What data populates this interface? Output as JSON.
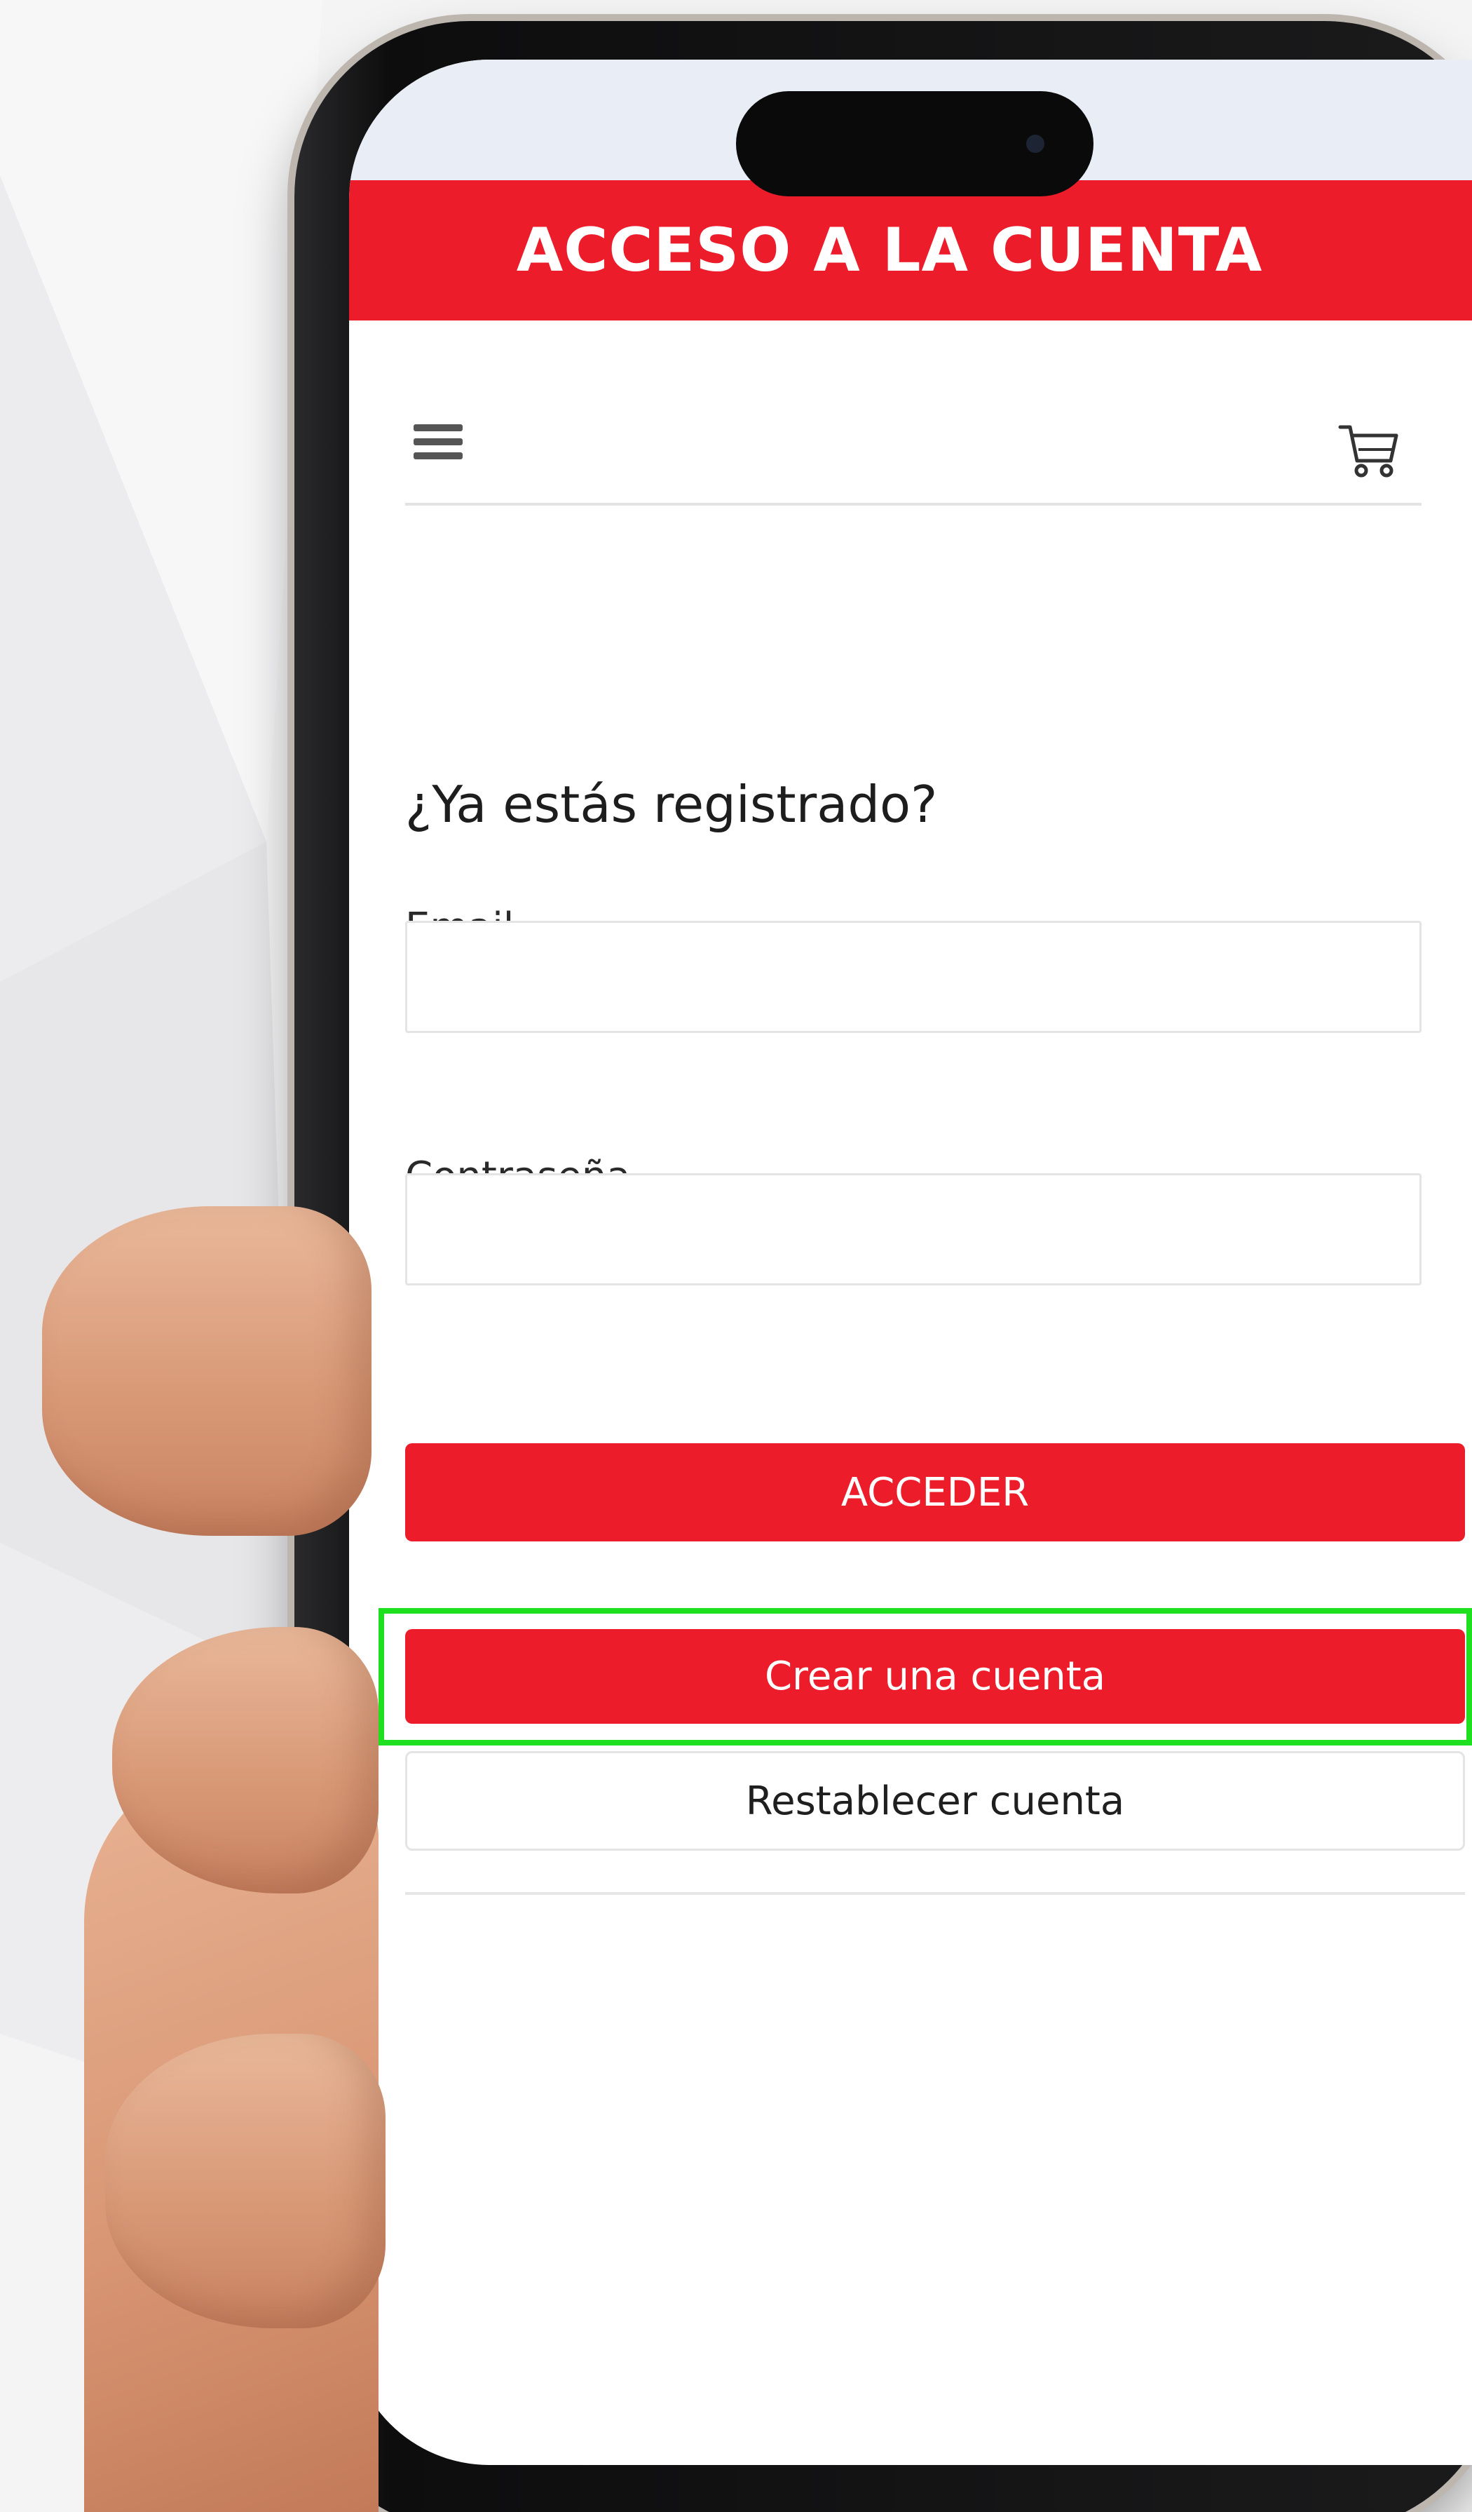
{
  "header": {
    "title": "ACCESO A LA CUENTA"
  },
  "nav": {
    "menu_icon": "hamburger-menu-icon",
    "cart_icon": "shopping-cart-icon"
  },
  "login": {
    "heading": "¿Ya estás registrado?",
    "email_label": "Email",
    "email_value": "",
    "password_label": "Contraseña",
    "password_value": "",
    "submit_label": "ACCEDER",
    "create_account_label": "Crear una cuenta",
    "reset_account_label": "Restablecer cuenta"
  },
  "colors": {
    "brand_red": "#ec1c2a",
    "highlight_green": "#1ee01e"
  }
}
